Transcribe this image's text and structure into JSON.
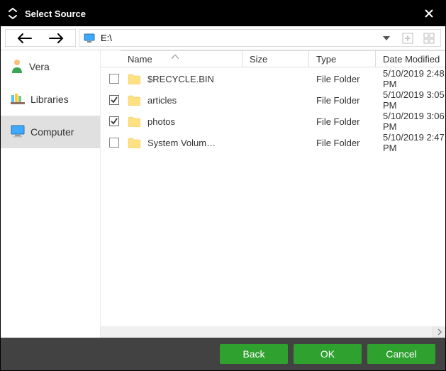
{
  "title": "Select Source",
  "path": "E:\\",
  "sidebar": {
    "items": [
      {
        "label": "Vera"
      },
      {
        "label": "Libraries"
      },
      {
        "label": "Computer"
      }
    ],
    "selected_index": 2
  },
  "columns": {
    "name": "Name",
    "size": "Size",
    "type": "Type",
    "date": "Date Modified"
  },
  "files": [
    {
      "checked": false,
      "name": "$RECYCLE.BIN",
      "size": "",
      "type": "File Folder",
      "date": "5/10/2019 2:48 PM"
    },
    {
      "checked": true,
      "name": "articles",
      "size": "",
      "type": "File Folder",
      "date": "5/10/2019 3:05 PM"
    },
    {
      "checked": true,
      "name": "photos",
      "size": "",
      "type": "File Folder",
      "date": "5/10/2019 3:06 PM"
    },
    {
      "checked": false,
      "name": "System Volum…",
      "size": "",
      "type": "File Folder",
      "date": "5/10/2019 2:47 PM"
    }
  ],
  "footer": {
    "back": "Back",
    "ok": "OK",
    "cancel": "Cancel"
  }
}
